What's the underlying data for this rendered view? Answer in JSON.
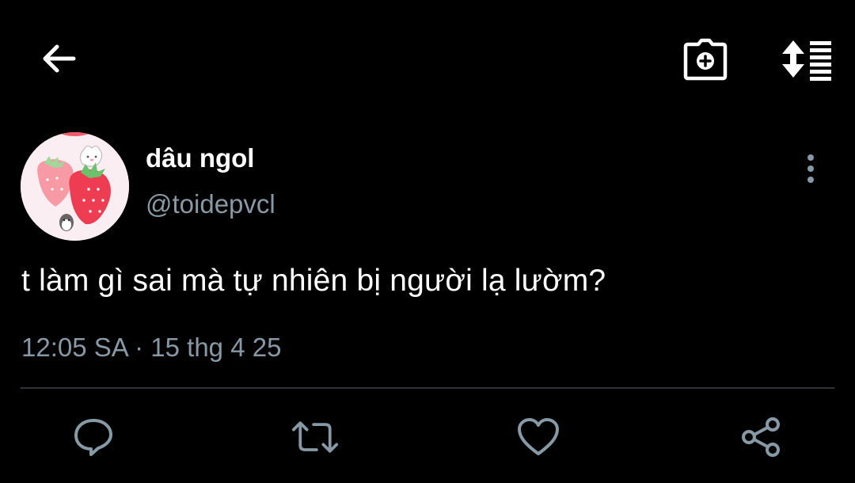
{
  "header": {
    "back_icon": "arrow-left-icon",
    "camera_icon": "camera-plus-icon",
    "sort_icon": "sort-list-icon"
  },
  "tweet": {
    "display_name": "dâu ngol",
    "handle": "@toidepvcl",
    "text": "t làm gì sai mà tự nhiên bị người lạ lườm?",
    "timestamp": "12:05 SA · 15 thg 4 25",
    "avatar_icon": "strawberry-avatar",
    "more_icon": "more-vertical-icon"
  },
  "actions": {
    "reply_icon": "reply-icon",
    "retweet_icon": "retweet-icon",
    "like_icon": "heart-icon",
    "share_icon": "share-icon"
  },
  "colors": {
    "background": "#000000",
    "primary_text": "#ffffff",
    "secondary_text": "#8899a6",
    "divider": "#2f3336"
  }
}
